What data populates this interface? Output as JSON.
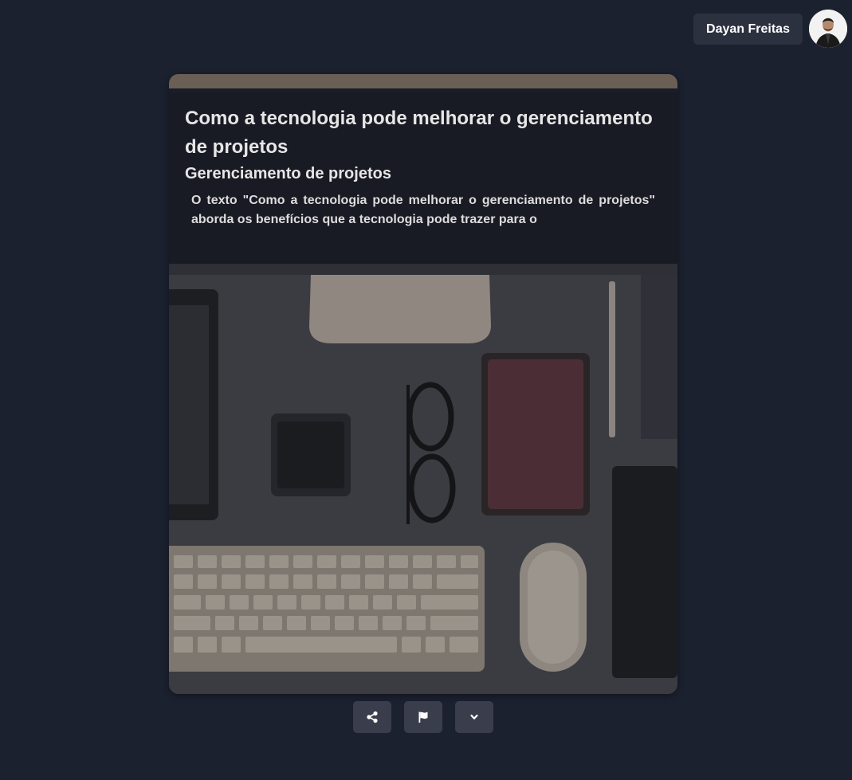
{
  "header": {
    "user_name": "Dayan Freitas"
  },
  "post": {
    "title": "Como a tecnologia pode melhorar o gerenciamento de projetos",
    "category": "Gerenciamento de projetos",
    "excerpt": "O texto \"Como a tecnologia pode melhorar o gerenciamento de projetos\" aborda os benefícios que a tecnologia pode trazer para o"
  },
  "actions": {
    "icons": [
      "share-icon",
      "flag-icon",
      "chevron-down-icon"
    ]
  },
  "colors": {
    "background": "#1c2130",
    "chip": "#2c3140",
    "action_button": "#3a3e4c",
    "overlay": "#161822"
  }
}
